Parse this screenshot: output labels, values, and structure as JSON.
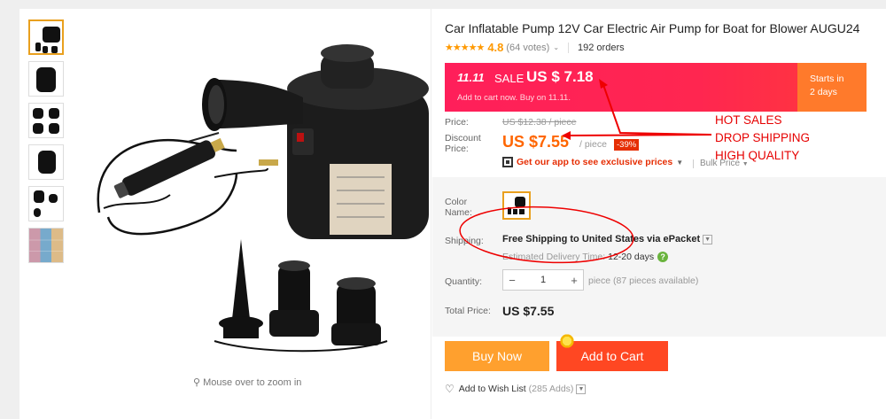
{
  "product": {
    "title": "Car Inflatable Pump 12V Car Electric Air Pump for Boat for Blower AUGU24",
    "rating_score": "4.8",
    "votes": "(64 votes)",
    "orders": "192 orders",
    "stars": "★★★★★"
  },
  "banner": {
    "event": "11.11",
    "sale_label": "SALE",
    "sale_price": "US $ 7.18",
    "cart_note": "Add to cart now. Buy on 11.11.",
    "starts_label": "Starts in",
    "starts_value": "2 days"
  },
  "pricing": {
    "price_label": "Price:",
    "original_price": "US $12.38 / piece",
    "discount_label_1": "Discount",
    "discount_label_2": "Price:",
    "discount_price": "US $7.55",
    "per_piece": "/ piece",
    "discount_pct": "-39%",
    "app_promo": "Get our app to see exclusive prices",
    "bulk_price": "Bulk Price"
  },
  "options": {
    "color_label_1": "Color",
    "color_label_2": "Name:",
    "shipping_label": "Shipping:",
    "shipping_text": "Free Shipping to United States via ePacket",
    "eta_label": "Estimated Delivery Time:",
    "eta_days": "12-20  days",
    "quantity_label": "Quantity:",
    "quantity_value": "1",
    "minus": "−",
    "plus": "+",
    "availability": "piece (87 pieces available)",
    "total_label": "Total Price:",
    "total_value": "US $7.55"
  },
  "actions": {
    "buy_now": "Buy Now",
    "add_to_cart": "Add to Cart",
    "wishlist": "Add to Wish List",
    "wishlist_count": "(285 Adds)"
  },
  "gallery": {
    "zoom_hint": "Mouse over to zoom in"
  },
  "annotation": {
    "line1": "HOT SALES",
    "line2": "DROP SHIPPING",
    "line3": "HIGH QUALITY"
  },
  "colors": {
    "accent_orange": "#ff4722",
    "buy_orange": "#ffa02e",
    "promo_red": "#e60000"
  }
}
